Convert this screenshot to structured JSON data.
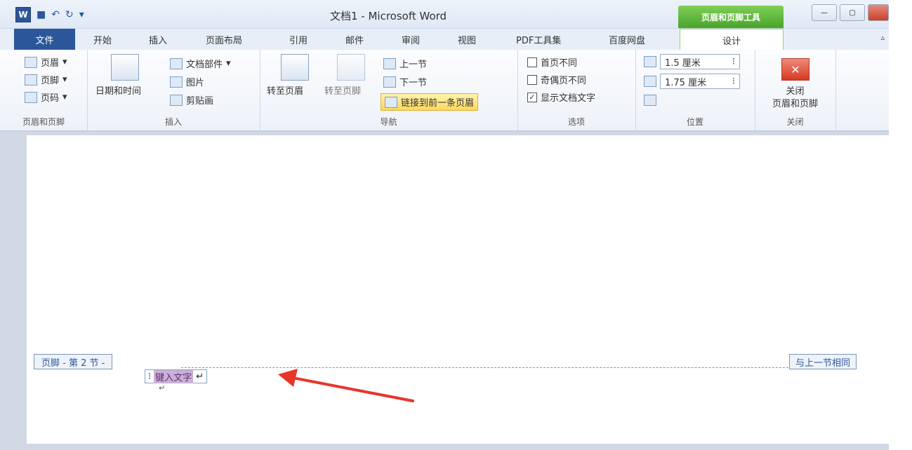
{
  "window": {
    "title": "文档1 - Microsoft Word",
    "context_tab_header": "页眉和页脚工具",
    "logo_letter": "W"
  },
  "tabs": {
    "file": "文件",
    "items": [
      "开始",
      "插入",
      "页面布局",
      "引用",
      "邮件",
      "审阅",
      "视图",
      "PDF工具集",
      "百度网盘"
    ],
    "active": "设计"
  },
  "ribbon": {
    "header_footer": {
      "header": "页眉",
      "footer": "页脚",
      "page_number": "页码",
      "label": "页眉和页脚"
    },
    "insert": {
      "date_time": "日期和时间",
      "doc_parts": "文档部件",
      "picture": "图片",
      "clip_art": "剪贴画",
      "label": "插入"
    },
    "navigation": {
      "goto_header": "转至页眉",
      "goto_footer": "转至页脚",
      "prev_section": "上一节",
      "next_section": "下一节",
      "link_previous": "链接到前一条页眉",
      "label": "导航"
    },
    "options": {
      "diff_first": "首页不同",
      "diff_odd_even": "奇偶页不同",
      "show_text": "显示文档文字",
      "label": "选项"
    },
    "position": {
      "header_from_top": "1.5 厘米",
      "footer_from_bottom": "1.75 厘米",
      "label": "位置"
    },
    "close": {
      "button": "关闭\n页眉和页脚",
      "button_line1": "关闭",
      "button_line2": "页眉和页脚",
      "label": "关闭"
    }
  },
  "document": {
    "footer_tag": "页脚 - 第 2 节 -",
    "same_as_previous": "与上一节相同",
    "field_text": "键入文字",
    "para_mark": "↵"
  },
  "colors": {
    "accent": "#2b579a",
    "context_green": "#4aa32c",
    "arrow_red": "#e8352a"
  }
}
